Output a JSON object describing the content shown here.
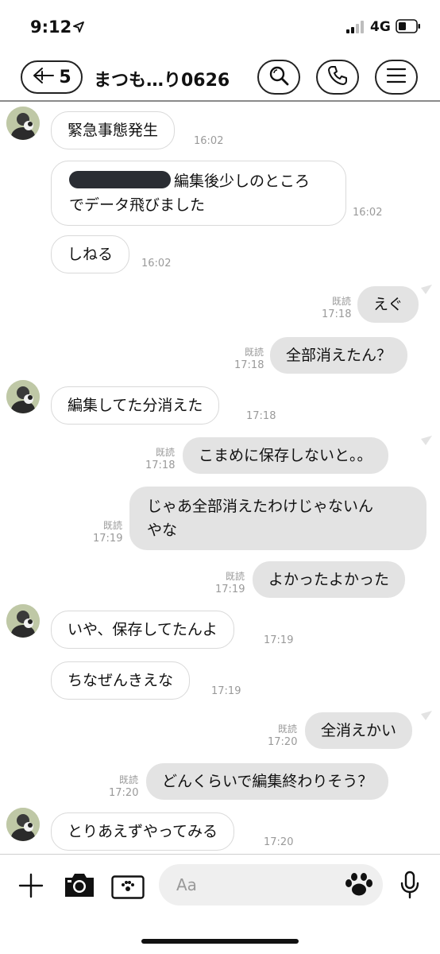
{
  "status_bar": {
    "time": "9:12",
    "network": "4G"
  },
  "header": {
    "back_count": "5",
    "title": "まつも…り0626"
  },
  "labels": {
    "read": "既読"
  },
  "messages": [
    {
      "side": "in",
      "text": "緊急事態発生",
      "time": "16:02"
    },
    {
      "side": "in",
      "line1": "編集後少しのところ",
      "line2": "でデータ飛びました",
      "time": "16:02"
    },
    {
      "side": "in",
      "text": "しねる",
      "time": "16:02"
    },
    {
      "side": "out",
      "text": "えぐ",
      "time": "17:18"
    },
    {
      "side": "out",
      "text": "全部消えたん？",
      "time": "17:18"
    },
    {
      "side": "in",
      "text": "編集してた分消えた",
      "time": "17:18"
    },
    {
      "side": "out",
      "text": "こまめに保存しないと。。",
      "time": "17:18"
    },
    {
      "side": "out",
      "line1": "じゃあ全部消えたわけじゃないん",
      "line2": "やな",
      "time": "17:19"
    },
    {
      "side": "out",
      "text": "よかったよかった",
      "time": "17:19"
    },
    {
      "side": "in",
      "text": "いや、保存してたんよ",
      "time": "17:19"
    },
    {
      "side": "in",
      "text": "ちなぜんきえな",
      "time": "17:19"
    },
    {
      "side": "out",
      "text": "全消えかい",
      "time": "17:20"
    },
    {
      "side": "out",
      "text": "どんくらいで編集終わりそう？",
      "time": "17:20"
    },
    {
      "side": "in",
      "text": "とりあえずやってみる",
      "time": "17:20"
    }
  ],
  "input": {
    "placeholder": "Aa"
  },
  "icons": {
    "location": "location-arrow-icon",
    "signal": "signal-icon",
    "battery": "battery-icon",
    "back": "back-arrow-icon",
    "search": "search-icon",
    "call": "phone-icon",
    "menu": "menu-icon",
    "plus": "plus-icon",
    "camera": "camera-icon",
    "image": "image-icon",
    "sticker": "paw-icon",
    "mic": "microphone-icon"
  }
}
